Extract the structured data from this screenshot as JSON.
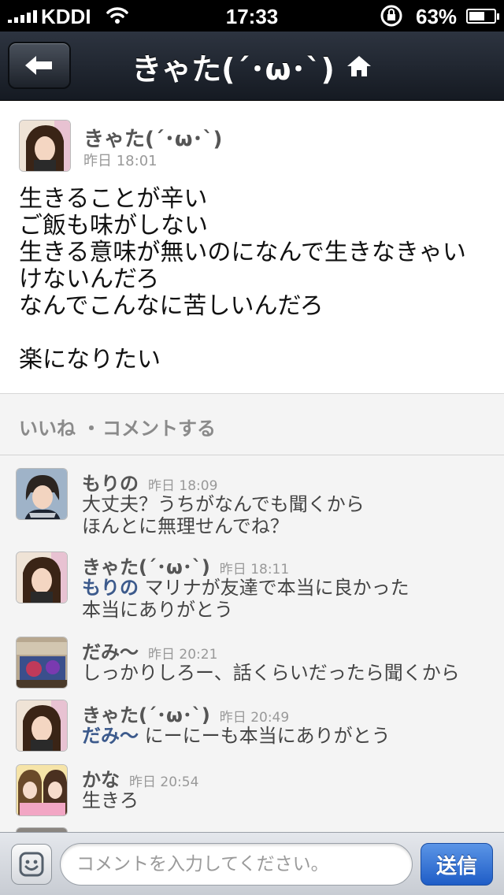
{
  "status_bar": {
    "carrier": "KDDI",
    "time": "17:33",
    "battery_percent": "63%",
    "battery_level": 0.63,
    "icons": [
      "signal-icon",
      "wifi-icon",
      "rotation-lock-icon",
      "battery-icon"
    ]
  },
  "nav": {
    "title": "きゃた(´･ω･`)",
    "back_icon": "back-arrow-icon",
    "home_icon": "home-icon"
  },
  "post": {
    "author": "きゃた(´･ω･`)",
    "time": "昨日 18:01",
    "lines": [
      "生きることが辛い",
      "ご飯も味がしない",
      "生きる意味が無いのになんで生きなきゃい",
      "けないんだろ",
      "なんでこんなに苦しいんだろ",
      "",
      "楽になりたい"
    ]
  },
  "actions": {
    "like": "いいね",
    "separator": "・",
    "comment": "コメントする"
  },
  "comments": [
    {
      "name": "もりの",
      "time": "昨日 18:09",
      "mention": "",
      "text": "大丈夫？うちがなんでも聞くから",
      "text2": "ほんとに無理せんでね？"
    },
    {
      "name": "きゃた(´･ω･`)",
      "time": "昨日 18:11",
      "mention": "もりの",
      "text": " マリナが友達で本当に良かった",
      "text2": "本当にありがとう"
    },
    {
      "name": "だみ〜",
      "time": "昨日 20:21",
      "mention": "",
      "text": "しっかりしろー、話くらいだったら聞くから",
      "text2": ""
    },
    {
      "name": "きゃた(´･ω･`)",
      "time": "昨日 20:49",
      "mention": "だみ〜",
      "text": " にーにーも本当にありがとう",
      "text2": ""
    },
    {
      "name": "かな",
      "time": "昨日 20:54",
      "mention": "",
      "text": "生きろ",
      "text2": ""
    }
  ],
  "compose": {
    "placeholder": "コメントを入力してください。",
    "send_label": "送信",
    "emoji_icon": "smiley-icon"
  },
  "colors": {
    "nav_bar": "#1f242d",
    "mention": "#3c5a8c",
    "send_button": "#2f6fd6",
    "background": "#f4f4f4"
  }
}
